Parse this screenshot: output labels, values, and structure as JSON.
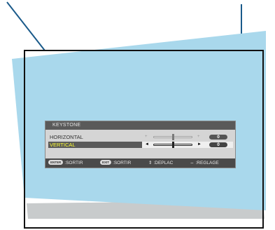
{
  "colors": {
    "background": "#ffffff",
    "screen_fill": "#a9d8ec",
    "screen_shadow": "#c8cbcc",
    "frame": "#111111",
    "leader_line": "#1a5a8a",
    "osd_title_bg": "#5a5a5a",
    "osd_body_bg": "#d5d5d5",
    "osd_selected_text": "#ffff33"
  },
  "osd": {
    "title": "KEYSTONE",
    "rows": [
      {
        "label": "HORIZONTAL",
        "value": "0",
        "slider_position": 0.5,
        "selected": false
      },
      {
        "label": "VERTICAL",
        "value": "0",
        "slider_position": 0.5,
        "selected": true
      }
    ],
    "arrows": {
      "left": "◄",
      "right": "►",
      "left_dim": "+",
      "right_dim": "+"
    },
    "footer": [
      {
        "key": "ENTER",
        "text": ":SORTIR"
      },
      {
        "key": "EXIT",
        "text": ":SORTIR"
      },
      {
        "glyph": "⇕",
        "text": ":DEPLAC"
      },
      {
        "glyph": "⇔",
        "text": ":REGLAGE"
      }
    ]
  }
}
